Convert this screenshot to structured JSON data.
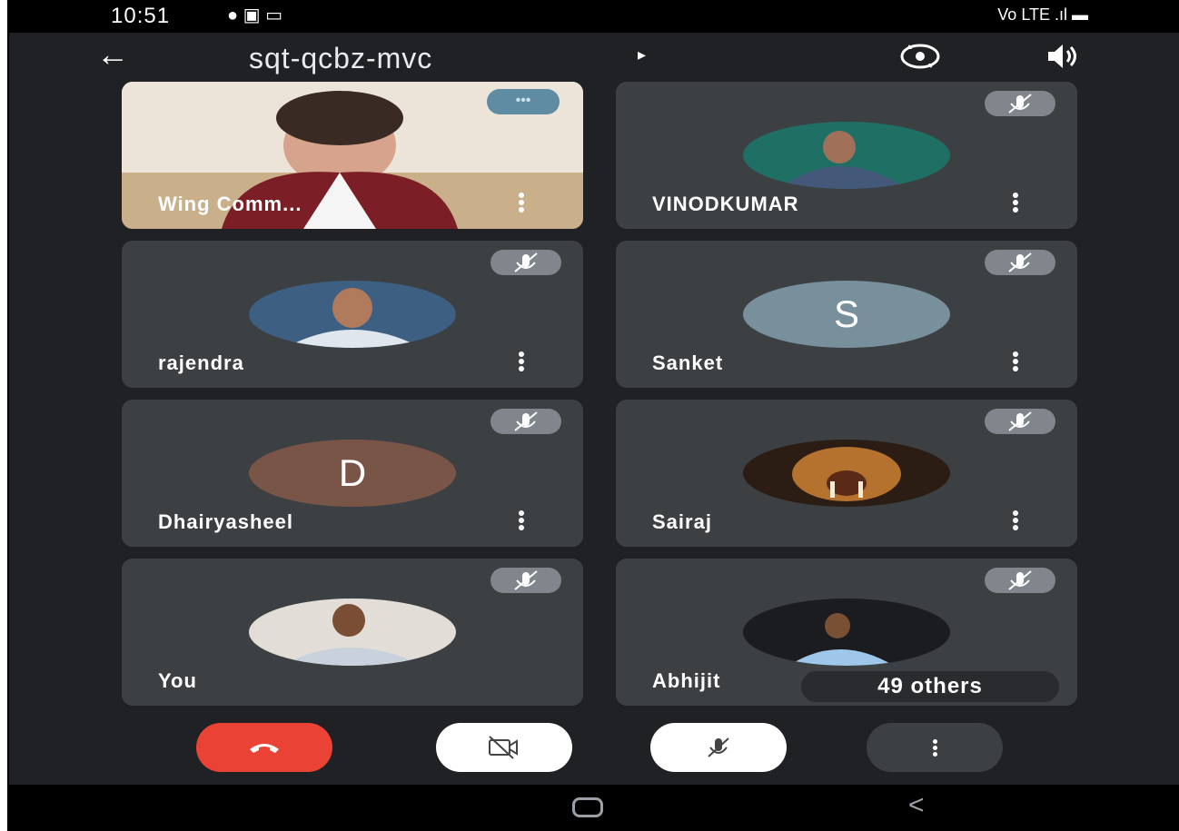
{
  "status_bar": {
    "time": "10:51",
    "left_icons": "● ▣ ▭",
    "right_icons": "Vo LTE .ıl ▬"
  },
  "header": {
    "title": "sqt-qcbz-mvc",
    "caret": "▸",
    "back_icon": "←"
  },
  "participants": [
    {
      "name": "Wing Comm...",
      "type": "video",
      "badge": "•••"
    },
    {
      "name": "VINODKUMAR",
      "type": "photo",
      "muted": true
    },
    {
      "name": "rajendra",
      "type": "photo",
      "muted": true
    },
    {
      "name": "Sanket",
      "type": "initial",
      "initial": "S",
      "avatar_color": "#78909c",
      "muted": true
    },
    {
      "name": "Dhairyasheel",
      "type": "initial",
      "initial": "D",
      "avatar_color": "#795548",
      "muted": true
    },
    {
      "name": "Sairaj",
      "type": "photo",
      "muted": true
    },
    {
      "name": "You",
      "type": "photo",
      "muted": true
    },
    {
      "name": "Abhijit",
      "type": "photo",
      "muted": true
    }
  ],
  "others_chip": "49 others",
  "controls": {
    "end_call_color": "#ea4335",
    "icons": [
      "end-call-icon",
      "camera-off-icon",
      "mic-off-icon",
      "more-vert-icon"
    ]
  },
  "nav": {
    "back": "<"
  }
}
